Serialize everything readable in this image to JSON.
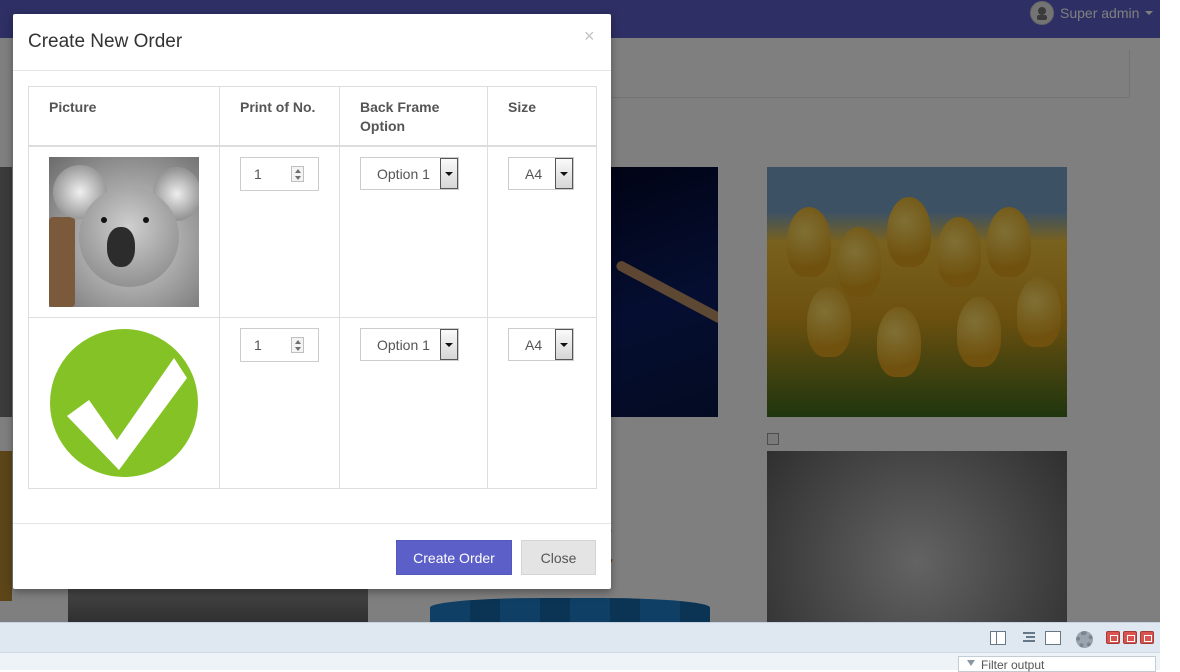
{
  "header": {
    "user_name": "Super admin"
  },
  "modal": {
    "title": "Create New Order",
    "close_glyph": "×",
    "table": {
      "columns": [
        "Picture",
        "Print of No.",
        "Back Frame Option",
        "Size"
      ],
      "rows": [
        {
          "picture": "koala",
          "print_no": "1",
          "frame": "Option 1",
          "size": "A4"
        },
        {
          "picture": "checkmark",
          "print_no": "1",
          "frame": "Option 1",
          "size": "A4"
        }
      ]
    },
    "footer": {
      "create_label": "Create Order",
      "close_label": "Close"
    }
  },
  "devtools": {
    "filter_placeholder": "Filter output"
  },
  "colors": {
    "brand": "#5c5fc8",
    "check_green": "#84c225"
  },
  "icons": [
    "user-avatar-icon",
    "caret-down-icon",
    "close-icon",
    "spin-up-icon",
    "spin-down-icon",
    "dropdown-arrow-icon",
    "layout-icon",
    "indent-icon",
    "window-icon",
    "gear-icon",
    "filter-icon"
  ]
}
